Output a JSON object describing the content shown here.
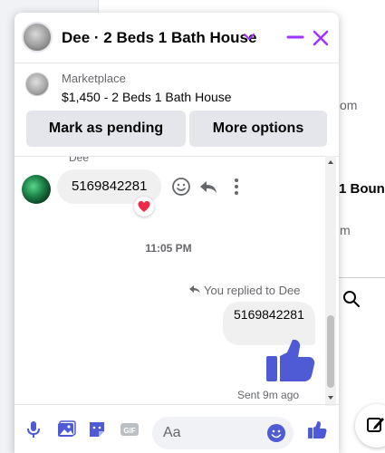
{
  "background": {
    "snippet_om": "om",
    "snippet_boun": "1 Boun",
    "snippet_m": "m"
  },
  "chat": {
    "header": {
      "title": "Dee · 2 Beds 1 Bath House"
    },
    "marketplace": {
      "label": "Marketplace",
      "listing": "$1,450 - 2 Beds 1 Bath House"
    },
    "actions": {
      "mark_pending": "Mark as pending",
      "more_options": "More options"
    },
    "thread": {
      "sender_name": "Dee",
      "incoming_message": "5169842281",
      "timestamp": "11:05 PM",
      "replied_note": "You replied to Dee",
      "outgoing_message": "5169842281",
      "sent_status": "Sent 9m ago"
    },
    "composer": {
      "placeholder": "Aa"
    }
  },
  "colors": {
    "accent": "#a033ff",
    "messenger_blue": "#4f5bd5",
    "reaction_red": "#f02849"
  },
  "icons": [
    "microphone-icon",
    "image-icon",
    "sticker-icon",
    "gif-icon",
    "emoji-icon",
    "like-icon",
    "reply-icon",
    "more-icon",
    "minimize-icon",
    "close-icon",
    "chevron-down-icon",
    "heart-icon",
    "search-icon",
    "edit-icon"
  ]
}
